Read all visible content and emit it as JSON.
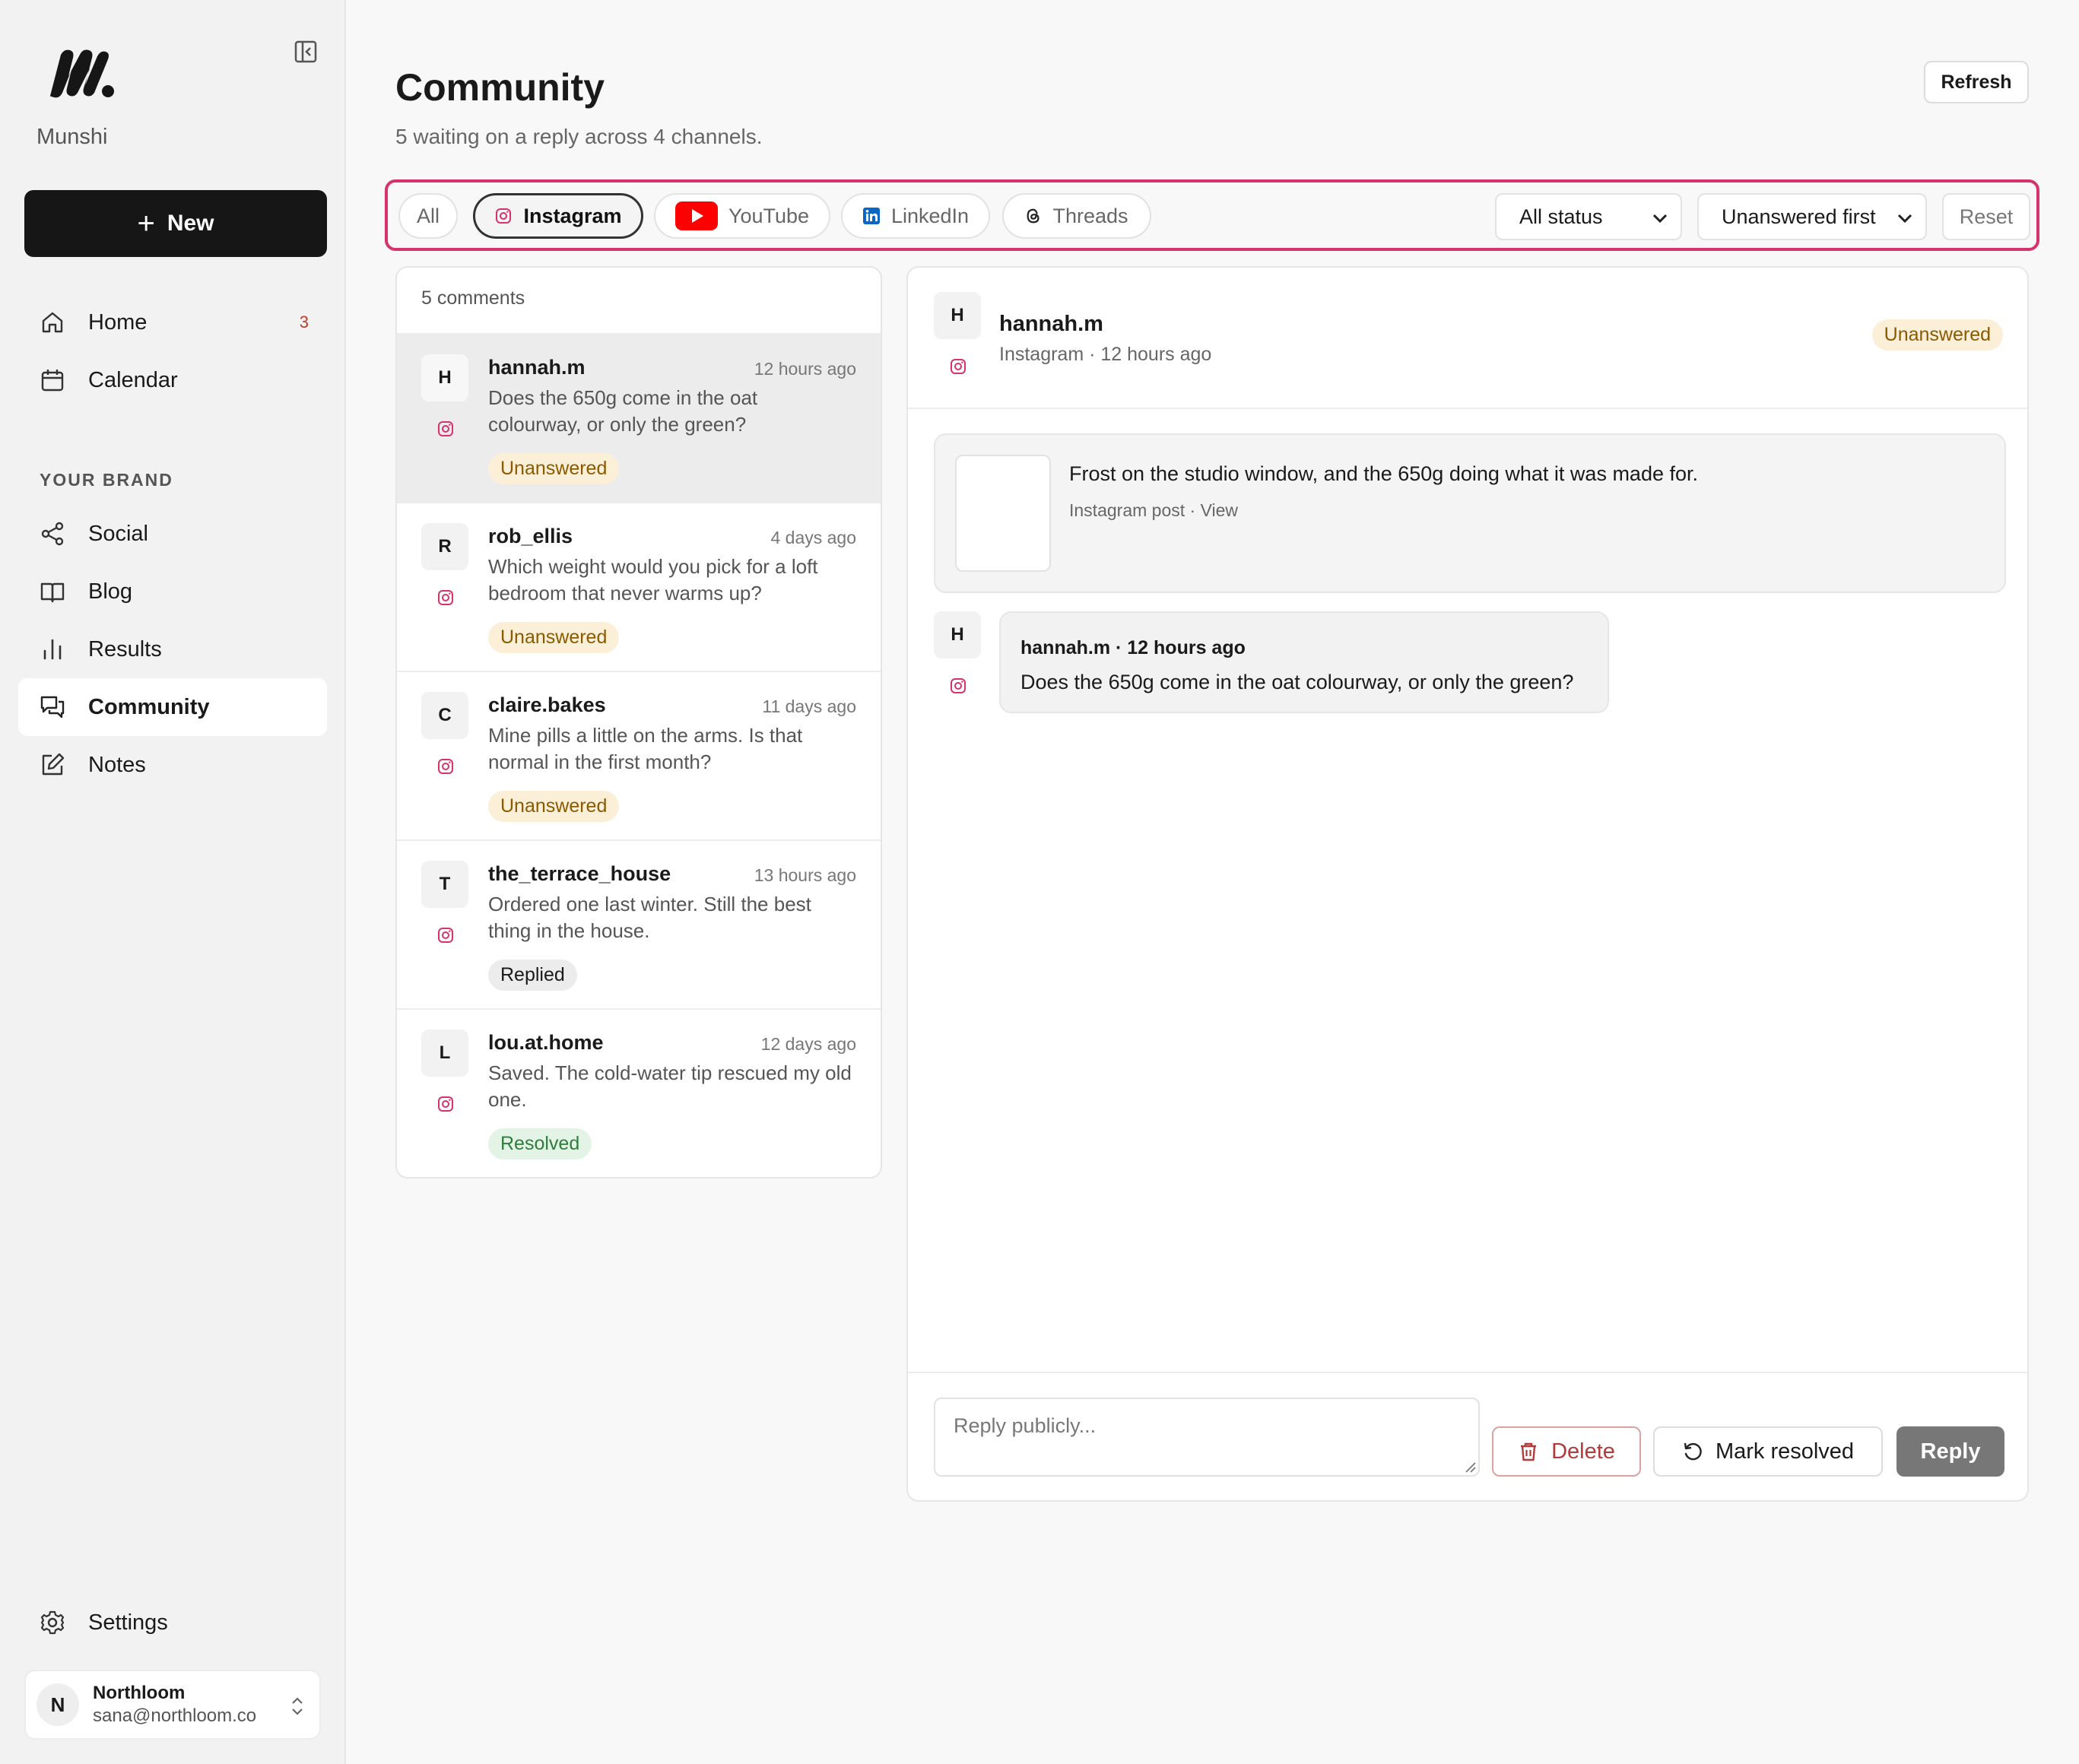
{
  "app": {
    "brand_name": "Munshi",
    "new_button_label": "New"
  },
  "nav": {
    "home": {
      "label": "Home",
      "badge": "3"
    },
    "calendar": {
      "label": "Calendar"
    },
    "section_label": "YOUR BRAND",
    "social": {
      "label": "Social"
    },
    "blog": {
      "label": "Blog"
    },
    "results": {
      "label": "Results"
    },
    "community": {
      "label": "Community"
    },
    "notes": {
      "label": "Notes"
    },
    "settings": {
      "label": "Settings"
    }
  },
  "account": {
    "initial": "N",
    "name": "Northloom",
    "email": "sana@northloom.co"
  },
  "header": {
    "title": "Community",
    "subtitle": "5 waiting on a reply across 4 channels.",
    "refresh_label": "Refresh"
  },
  "filters": {
    "channels": {
      "all": "All",
      "instagram": "Instagram",
      "youtube": "YouTube",
      "linkedin": "LinkedIn",
      "threads": "Threads"
    },
    "selected_channel": "Instagram",
    "status_select": "All status",
    "sort_select": "Unanswered first",
    "reset_label": "Reset"
  },
  "list": {
    "count_label": "5 comments",
    "items": [
      {
        "initial": "H",
        "user": "hannah.m",
        "time": "12 hours ago",
        "text": "Does the 650g come in the oat colourway, or only the green?",
        "status": "Unanswered"
      },
      {
        "initial": "R",
        "user": "rob_ellis",
        "time": "4 days ago",
        "text": "Which weight would you pick for a loft bedroom that never warms up?",
        "status": "Unanswered"
      },
      {
        "initial": "C",
        "user": "claire.bakes",
        "time": "11 days ago",
        "text": "Mine pills a little on the arms. Is that normal in the first month?",
        "status": "Unanswered"
      },
      {
        "initial": "T",
        "user": "the_terrace_house",
        "time": "13 hours ago",
        "text": "Ordered one last winter. Still the best thing in the house.",
        "status": "Replied"
      },
      {
        "initial": "L",
        "user": "lou.at.home",
        "time": "12 days ago",
        "text": "Saved. The cold-water tip rescued my old one.",
        "status": "Resolved"
      }
    ]
  },
  "detail": {
    "initial": "H",
    "user": "hannah.m",
    "meta": "Instagram · 12 hours ago",
    "status": "Unanswered",
    "post": {
      "caption": "Frost on the studio window, and the 650g doing what it was made for.",
      "source": "Instagram post · View"
    },
    "message": {
      "initial": "H",
      "header": "hannah.m · 12 hours ago",
      "text": "Does the 650g come in the oat colourway, or only the green?"
    },
    "composer": {
      "placeholder": "Reply publicly...",
      "delete_label": "Delete",
      "resolve_label": "Mark resolved",
      "reply_label": "Reply"
    }
  },
  "colors": {
    "accent_outline": "#d6336c",
    "instagram": "#d6336c",
    "youtube": "#ff0000",
    "linkedin": "#0a66c2",
    "unanswered_bg": "#fbefd8",
    "resolved_bg": "#e3f4e6"
  },
  "icons": {
    "logo": "munshi-logo",
    "collapse": "sidebar-collapse-icon",
    "home": "home-icon",
    "calendar": "calendar-icon",
    "social": "share-icon",
    "blog": "book-icon",
    "results": "bar-chart-icon",
    "community": "chat-icon",
    "notes": "edit-icon",
    "settings": "gear-icon",
    "delete": "trash-icon",
    "resolve": "undo-icon"
  }
}
